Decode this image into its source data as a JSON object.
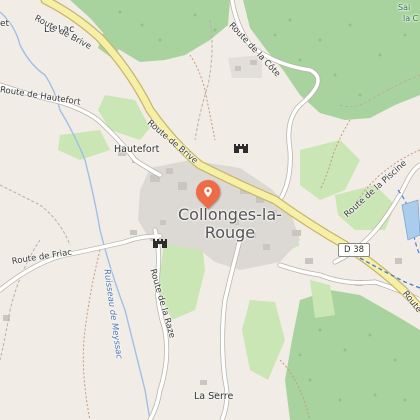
{
  "map": {
    "place_labels": {
      "le_lac": "Le Lac",
      "hautefort": "Hautefort",
      "la_serre": "La Serre",
      "town_line1": "Collonges-la-",
      "town_line2": "Rouge"
    },
    "road_labels": {
      "route_de_brive_top": "Route de Brive",
      "route_de_brive_mid": "Route de Brive",
      "route_de_hautefort": "Route de Hautefort",
      "route_de_la_cote": "Route de la Côte",
      "route_de_la_piscine": "Route de la Piscine",
      "route_de_friac": "Route de Friac",
      "route_de_la_raze": "Route de la Raze",
      "road_badge": "D 38"
    },
    "water_labels": {
      "ruisseau": "Ruisseau de Meyssac"
    },
    "clipped_labels": {
      "top_left_fragment": "et",
      "top_right_fragment": "Sai",
      "top_right_fragment_2": "la C"
    },
    "colors": {
      "land": "#f1ede6",
      "forest": "#a9d39e",
      "meadow": "#c9e6b4",
      "built": "#dcd9d4",
      "main_road": "#f6f0a6",
      "main_road_casing": "#c7b56a",
      "track": "#c0a080",
      "stream": "#9fc0e4",
      "pin": "#ef6b45"
    },
    "pois": [
      {
        "icon": "location-pin-icon"
      },
      {
        "icon": "castle-icon"
      },
      {
        "icon": "castle-icon"
      }
    ]
  }
}
